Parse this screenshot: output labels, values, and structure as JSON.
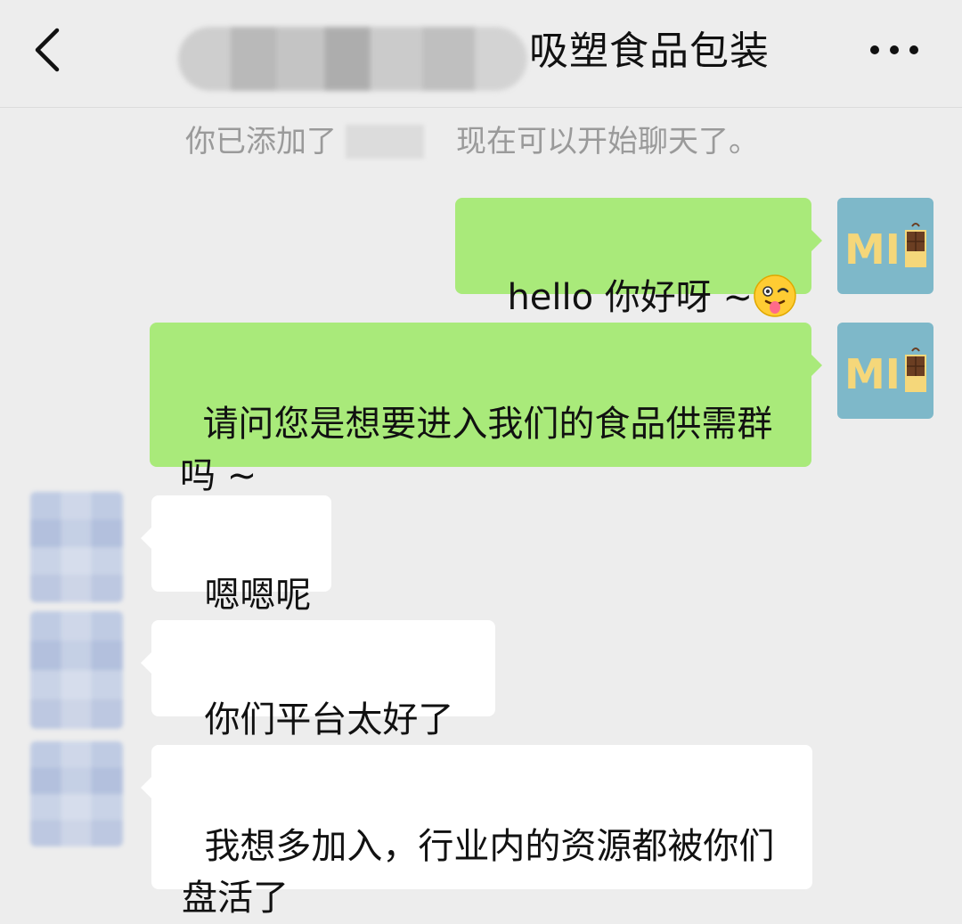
{
  "header": {
    "title": "吸塑食品包装",
    "back_icon": "chevron-left-icon",
    "more_icon": "more-horizontal-icon"
  },
  "system_message": {
    "prefix": "你已添加了",
    "suffix": "现在可以开始聊天了。"
  },
  "messages": [
    {
      "side": "out",
      "text": "hello 你好呀 ~",
      "emoji": "winking-tongue-emoji"
    },
    {
      "side": "out",
      "text": "请问您是想要进入我们的食品供需群吗 ~"
    },
    {
      "side": "in",
      "text": "嗯嗯呢"
    },
    {
      "side": "in",
      "text": "你们平台太好了"
    },
    {
      "side": "in",
      "text": "我想多加入，行业内的资源都被你们盘活了"
    }
  ],
  "my_avatar": {
    "text": "MI",
    "bg": "#7eb8c9",
    "fg": "#f5d77a"
  },
  "colors": {
    "outgoing_bubble": "#a9ea7a",
    "incoming_bubble": "#ffffff",
    "background": "#ededed"
  }
}
